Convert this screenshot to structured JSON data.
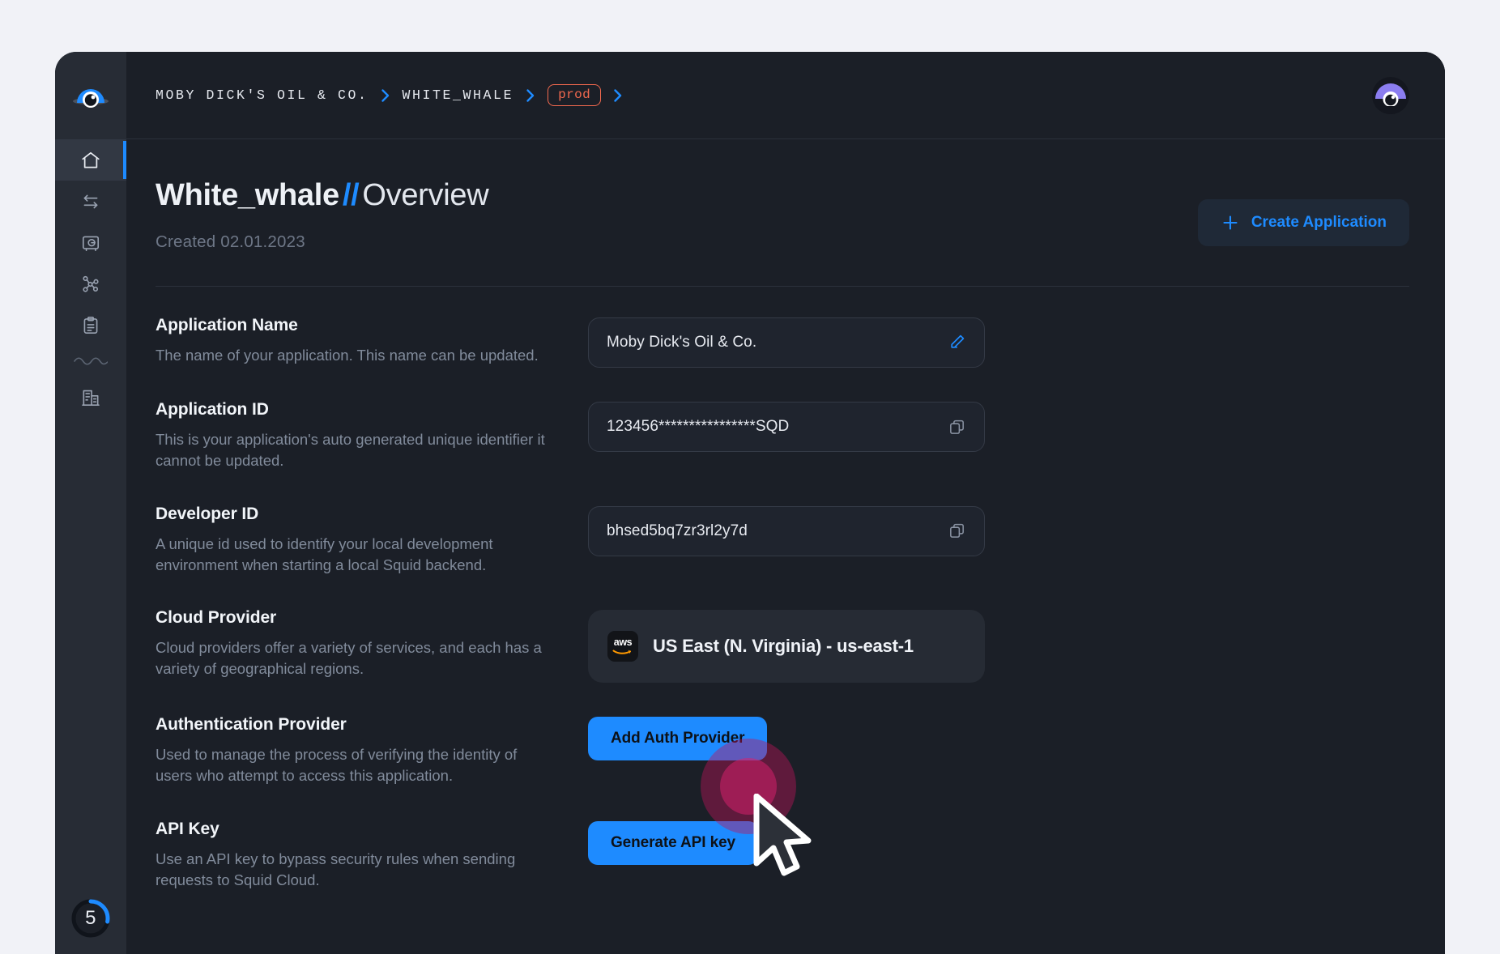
{
  "window": {
    "accent_blue": "#1e8bff",
    "badge_orange": "#f2694e",
    "sidebar_bg": "#272c35",
    "content_bg": "#1b1f27"
  },
  "sidebar": {
    "logo_name": "squid-logo",
    "items": [
      {
        "name": "sidebar-item-home",
        "icon": "home-icon",
        "active": true
      },
      {
        "name": "sidebar-item-integrations",
        "icon": "transfer-arrows-icon",
        "active": false
      },
      {
        "name": "sidebar-item-secrets",
        "icon": "vault-icon",
        "active": false
      },
      {
        "name": "sidebar-item-graph",
        "icon": "network-graph-icon",
        "active": false
      },
      {
        "name": "sidebar-item-logs",
        "icon": "clipboard-icon",
        "active": false
      },
      {
        "name": "sidebar-item-organization",
        "icon": "building-icon",
        "active": false
      }
    ],
    "progress_badge": {
      "value": "5",
      "percent": 28
    }
  },
  "topbar": {
    "breadcrumb": [
      {
        "label": "MOBY DICK'S OIL & CO.",
        "type": "text"
      },
      {
        "label": "WHITE_WHALE",
        "type": "text"
      },
      {
        "label": "prod",
        "type": "badge"
      }
    ],
    "avatar_name": "user-avatar"
  },
  "header": {
    "title_strong": "White_whale",
    "title_separator": "//",
    "title_light": "Overview",
    "created": "Created 02.01.2023",
    "create_button": "Create Application"
  },
  "fields": [
    {
      "id": "application-name",
      "label": "Application Name",
      "description": "The name of your application. This name can be updated.",
      "control": "input",
      "value": "Moby Dick's Oil & Co.",
      "icon": "pencil-edit-icon",
      "icon_color": "#1e8bff"
    },
    {
      "id": "application-id",
      "label": "Application ID",
      "description": "This is your application's auto generated unique identifier it cannot be updated.",
      "control": "input",
      "value": "123456****************SQD",
      "icon": "copy-icon",
      "icon_color": "#8a93a3"
    },
    {
      "id": "developer-id",
      "label": "Developer ID",
      "description": "A unique id used to identify your local development environment when starting a local Squid backend.",
      "control": "input",
      "value": "bhsed5bq7zr3rl2y7d",
      "icon": "copy-icon",
      "icon_color": "#8a93a3"
    },
    {
      "id": "cloud-provider",
      "label": "Cloud Provider",
      "description": "Cloud providers offer a variety of services, and each has a variety of geographical regions.",
      "control": "provider-card",
      "provider_logo": "aws-logo",
      "provider_logo_text": "aws",
      "value": "US East (N. Virginia) - us-east-1"
    },
    {
      "id": "authentication-provider",
      "label": "Authentication Provider",
      "description": "Used to manage the process of verifying the identity of users who attempt to access this application.",
      "control": "button",
      "value": "Add Auth Provider"
    },
    {
      "id": "api-key",
      "label": "API Key",
      "description": "Use an API key to bypass security rules when sending requests to Squid Cloud.",
      "control": "button",
      "value": "Generate API key"
    }
  ],
  "overlay": {
    "cursor_name": "mouse-cursor",
    "ripple_name": "click-ripple"
  }
}
